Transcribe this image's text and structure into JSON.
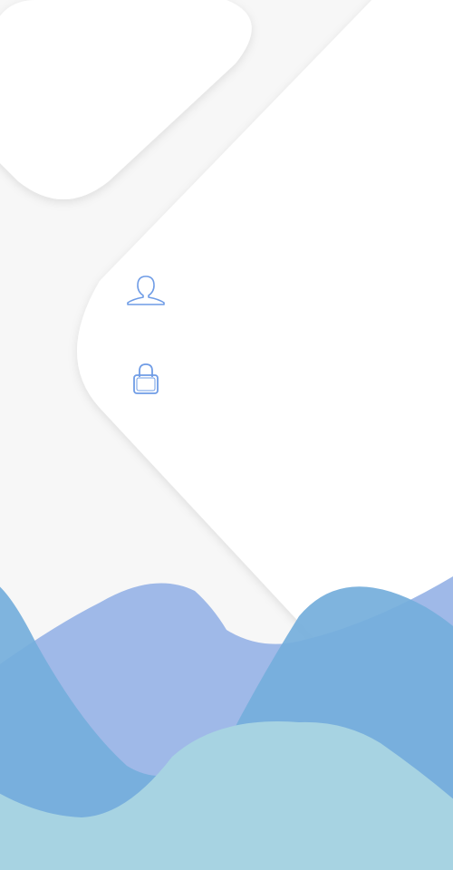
{
  "colors": {
    "background": "#f7f7f7",
    "card": "#ffffff",
    "icon_stroke": "#6f9ce6",
    "wave_purple": "#9fb9e8",
    "wave_blue": "#74aedb",
    "wave_light": "#a7d3e2"
  },
  "login_form": {
    "username_icon": "user-icon",
    "password_icon": "lock-icon"
  }
}
